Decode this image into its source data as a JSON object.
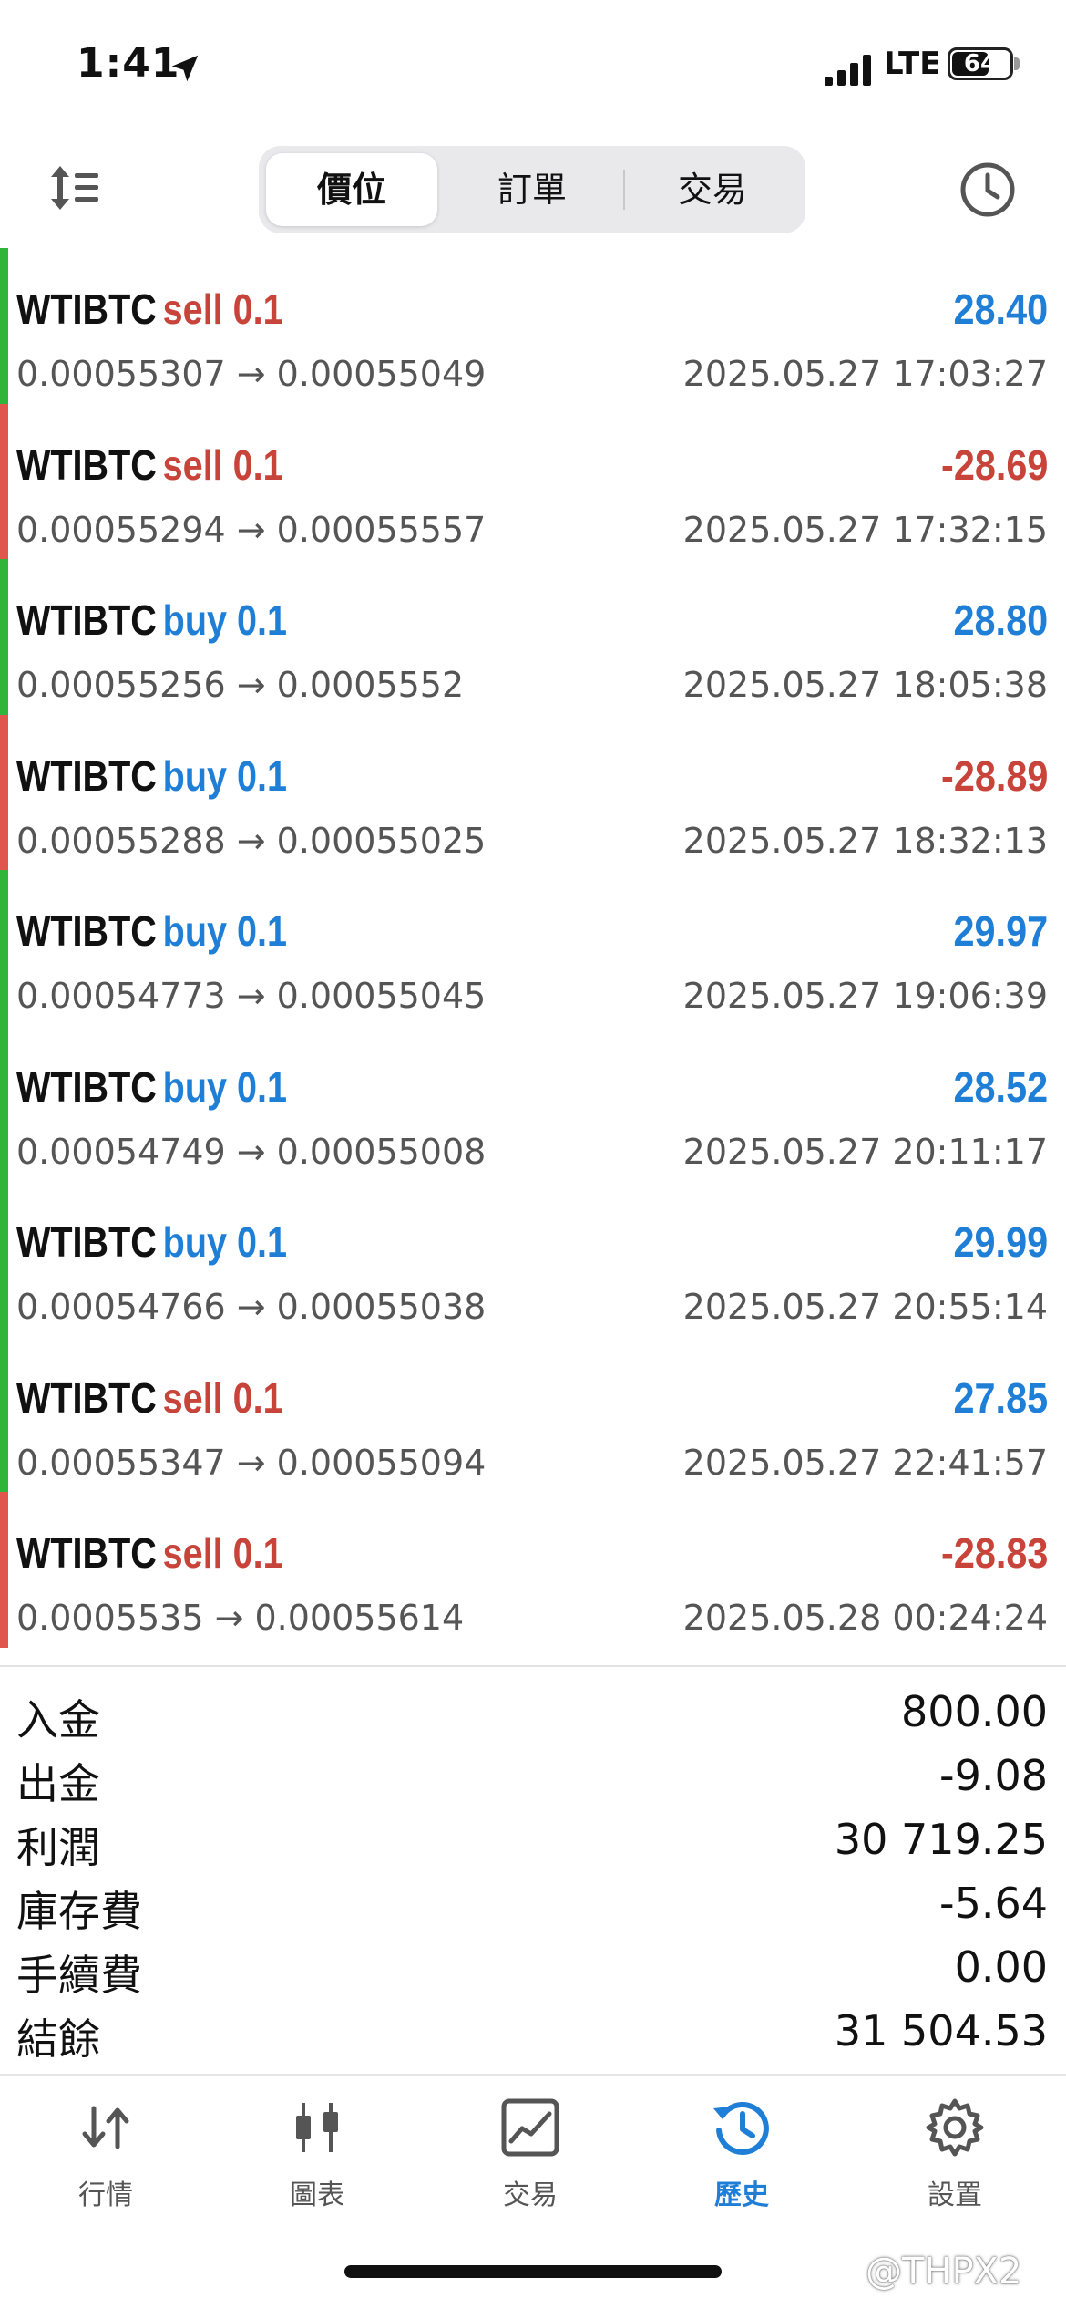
{
  "status_bar": {
    "time": "1:41",
    "network": "LTE",
    "battery": "64"
  },
  "header": {
    "tabs": [
      {
        "label": "價位",
        "active": true
      },
      {
        "label": "訂單",
        "active": false
      },
      {
        "label": "交易",
        "active": false
      }
    ]
  },
  "trades": [
    {
      "symbol": "WTIBTC",
      "side": "sell 0.1",
      "side_color": "red",
      "profit": "28.40",
      "profit_color": "blue",
      "bar": "#2fb53a",
      "prices": "0.00055307 → 0.00055049",
      "time": "2025.05.27 17:03:27"
    },
    {
      "symbol": "WTIBTC",
      "side": "sell 0.1",
      "side_color": "red",
      "profit": "-28.69",
      "profit_color": "red",
      "bar": "#e0564c",
      "prices": "0.00055294 → 0.00055557",
      "time": "2025.05.27 17:32:15"
    },
    {
      "symbol": "WTIBTC",
      "side": "buy 0.1",
      "side_color": "blue",
      "profit": "28.80",
      "profit_color": "blue",
      "bar": "#2fb53a",
      "prices": "0.00055256 → 0.0005552",
      "time": "2025.05.27 18:05:38"
    },
    {
      "symbol": "WTIBTC",
      "side": "buy 0.1",
      "side_color": "blue",
      "profit": "-28.89",
      "profit_color": "red",
      "bar": "#e0564c",
      "prices": "0.00055288 → 0.00055025",
      "time": "2025.05.27 18:32:13"
    },
    {
      "symbol": "WTIBTC",
      "side": "buy 0.1",
      "side_color": "blue",
      "profit": "29.97",
      "profit_color": "blue",
      "bar": "#2fb53a",
      "prices": "0.00054773 → 0.00055045",
      "time": "2025.05.27 19:06:39"
    },
    {
      "symbol": "WTIBTC",
      "side": "buy 0.1",
      "side_color": "blue",
      "profit": "28.52",
      "profit_color": "blue",
      "bar": "#2fb53a",
      "prices": "0.00054749 → 0.00055008",
      "time": "2025.05.27 20:11:17"
    },
    {
      "symbol": "WTIBTC",
      "side": "buy 0.1",
      "side_color": "blue",
      "profit": "29.99",
      "profit_color": "blue",
      "bar": "#2fb53a",
      "prices": "0.00054766 → 0.00055038",
      "time": "2025.05.27 20:55:14"
    },
    {
      "symbol": "WTIBTC",
      "side": "sell 0.1",
      "side_color": "red",
      "profit": "27.85",
      "profit_color": "blue",
      "bar": "#2fb53a",
      "prices": "0.00055347 → 0.00055094",
      "time": "2025.05.27 22:41:57"
    },
    {
      "symbol": "WTIBTC",
      "side": "sell 0.1",
      "side_color": "red",
      "profit": "-28.83",
      "profit_color": "red",
      "bar": "#e0564c",
      "prices": "0.0005535 → 0.00055614",
      "time": "2025.05.28 00:24:24"
    }
  ],
  "summary": [
    {
      "label": "入金",
      "value": "800.00"
    },
    {
      "label": "出金",
      "value": "-9.08"
    },
    {
      "label": "利潤",
      "value": "30 719.25"
    },
    {
      "label": "庫存費",
      "value": "-5.64"
    },
    {
      "label": "手續費",
      "value": "0.00"
    },
    {
      "label": "結餘",
      "value": "31 504.53"
    }
  ],
  "bottom_nav": [
    {
      "label": "行情",
      "icon": "quotes-icon",
      "active": false
    },
    {
      "label": "圖表",
      "icon": "chart-icon",
      "active": false
    },
    {
      "label": "交易",
      "icon": "trade-icon",
      "active": false
    },
    {
      "label": "歷史",
      "icon": "history-icon",
      "active": true
    },
    {
      "label": "設置",
      "icon": "settings-icon",
      "active": false
    }
  ],
  "colors": {
    "blue": "#1f7fd6",
    "red": "#c8443a",
    "green_bar": "#2fb53a",
    "red_bar": "#e0564c"
  },
  "watermark": "@THPX2"
}
